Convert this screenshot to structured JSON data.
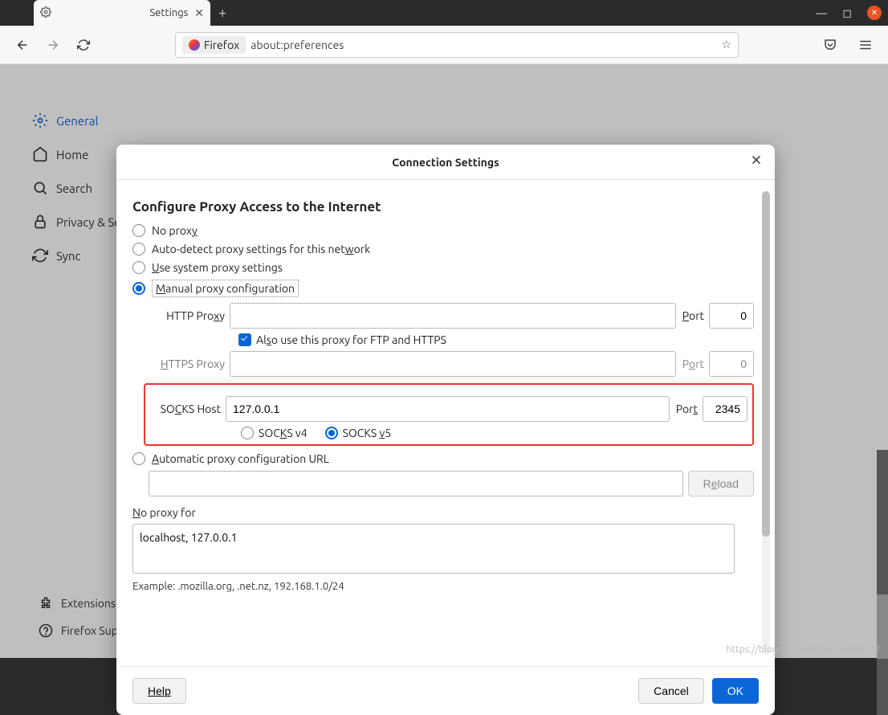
{
  "window": {
    "tab_title": "Settings",
    "url_identity": "Firefox",
    "url": "about:preferences"
  },
  "sidebar": {
    "items": [
      {
        "label": "General"
      },
      {
        "label": "Home"
      },
      {
        "label": "Search"
      },
      {
        "label": "Privacy & Security"
      },
      {
        "label": "Sync"
      }
    ],
    "bottom": [
      {
        "label": "Extensions & Themes"
      },
      {
        "label": "Firefox Support"
      }
    ]
  },
  "dialog": {
    "title": "Connection Settings",
    "section_title": "Configure Proxy Access to the Internet",
    "radio_no_proxy": "No proxy",
    "radio_auto_detect": "Auto-detect proxy settings for this network",
    "radio_system": "Use system proxy settings",
    "radio_manual": "Manual proxy configuration",
    "http_proxy_label": "HTTP Proxy",
    "http_proxy_value": "",
    "port_label": "Port",
    "http_port": "0",
    "also_use_label": "Also use this proxy for FTP and HTTPS",
    "https_proxy_label": "HTTPS Proxy",
    "https_proxy_value": "",
    "https_port": "0",
    "socks_host_label": "SOCKS Host",
    "socks_host_value": "127.0.0.1",
    "socks_port": "2345",
    "socks_v4": "SOCKS v4",
    "socks_v5": "SOCKS v5",
    "radio_pac": "Automatic proxy configuration URL",
    "pac_value": "",
    "reload": "Reload",
    "no_proxy_for_label": "No proxy for",
    "no_proxy_for_value": "localhost, 127.0.0.1",
    "example": "Example: .mozilla.org, .net.nz, 192.168.1.0/24",
    "help": "Help",
    "cancel": "Cancel",
    "ok": "OK"
  },
  "watermark": "https://blog.csdn.net/qq_45595732"
}
